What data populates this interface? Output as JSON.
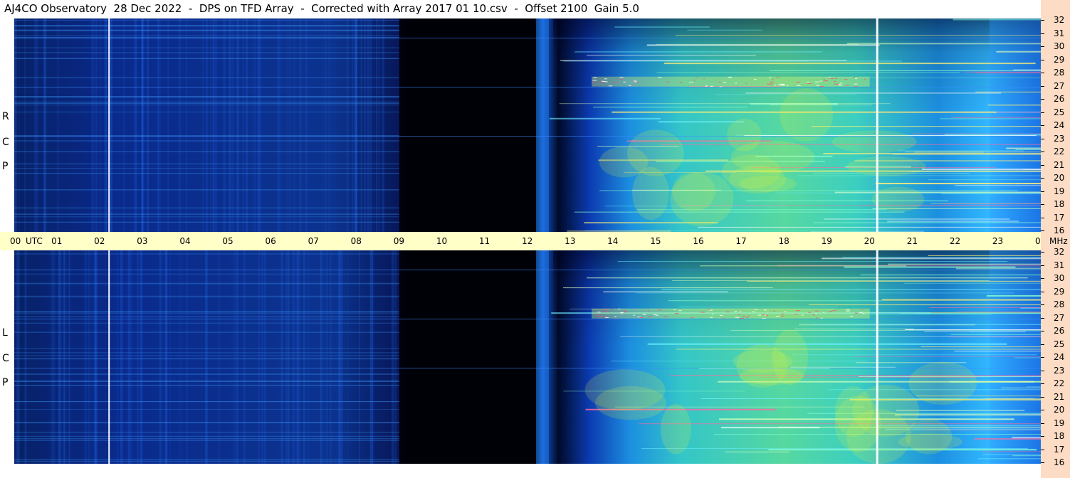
{
  "header": {
    "title": "AJ4CO Observatory  28 Dec 2022  -  DPS on TFD Array  -  Corrected with Array 2017 01 10.csv  -  Offset 2100  Gain 5.0"
  },
  "panels": {
    "top_label": [
      "R",
      "C",
      "P"
    ],
    "bottom_label": [
      "L",
      "C",
      "P"
    ]
  },
  "colors": {
    "background": "#000008",
    "low": "#0a2a8c",
    "mid": "#1e7cff",
    "high": "#3ee0c8",
    "peak": "#e6f23a",
    "utc_band": "#ffffc8",
    "scale_band": "#fcdcc4"
  },
  "chart_data": {
    "type": "heatmap",
    "title": "AJ4CO Observatory  28 Dec 2022  -  DPS on TFD Array  -  Corrected with Array 2017 01 10.csv  -  Offset 2100  Gain 5.0",
    "x_axis": {
      "unit_label": "UTC",
      "ticks": [
        "00",
        "01",
        "02",
        "03",
        "04",
        "05",
        "06",
        "07",
        "08",
        "09",
        "10",
        "11",
        "12",
        "13",
        "14",
        "15",
        "16",
        "17",
        "18",
        "19",
        "20",
        "21",
        "22",
        "23",
        "00"
      ],
      "range_hours": [
        0,
        24
      ]
    },
    "y_axis": {
      "unit_label": "MHz",
      "ticks": [
        "32",
        "31",
        "30",
        "29",
        "28",
        "27",
        "26",
        "25",
        "24",
        "23",
        "22",
        "21",
        "20",
        "19",
        "18",
        "17",
        "16"
      ],
      "range_mhz": [
        16,
        32
      ]
    },
    "panels": [
      {
        "polarization": "RCP"
      },
      {
        "polarization": "LCP"
      }
    ],
    "activity_bands_hours": [
      {
        "start": 0,
        "end": 9,
        "level": "low"
      },
      {
        "start": 9,
        "end": 12.2,
        "level": "quiet"
      },
      {
        "start": 12.2,
        "end": 12.5,
        "level": "mid"
      },
      {
        "start": 13,
        "end": 22.8,
        "level": "high"
      },
      {
        "start": 22.8,
        "end": 23.1,
        "level": "mid"
      },
      {
        "start": 23.1,
        "end": 24,
        "level": "mid"
      }
    ],
    "markers_hours": [
      2.2,
      20.15
    ]
  }
}
